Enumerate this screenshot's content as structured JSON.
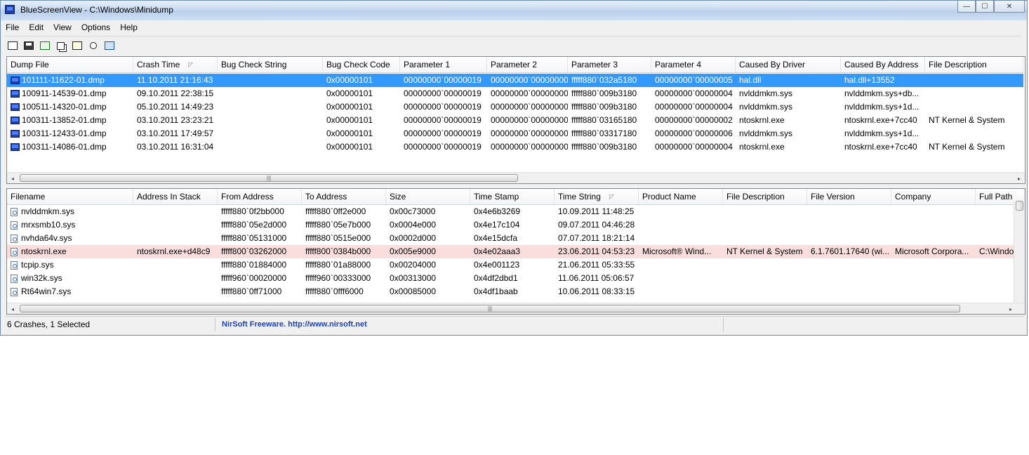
{
  "window": {
    "title": "BlueScreenView  -  C:\\Windows\\Minidump",
    "minimize_glyph": "—",
    "maximize_glyph": "☐",
    "close_glyph": "✕"
  },
  "menu": [
    "File",
    "Edit",
    "View",
    "Options",
    "Help"
  ],
  "toolbar": {
    "icons": [
      "html-report-icon",
      "save-icon",
      "refresh-icon",
      "copy-icon",
      "properties-icon",
      "find-icon",
      "exit-icon"
    ]
  },
  "crashes": {
    "columns": [
      "Dump File",
      "Crash Time",
      "Bug Check String",
      "Bug Check Code",
      "Parameter 1",
      "Parameter 2",
      "Parameter 3",
      "Parameter 4",
      "Caused By Driver",
      "Caused By Address",
      "File Description"
    ],
    "sorted_column": "Crash Time",
    "sort_glyph": "◸",
    "rows": [
      [
        "101111-11622-01.dmp",
        "11.10.2011 21:16:43",
        "",
        "0x00000101",
        "00000000`00000019",
        "00000000`00000000",
        "fffff880`032a5180",
        "00000000`00000005",
        "hal.dll",
        "hal.dll+13552",
        ""
      ],
      [
        "100911-14539-01.dmp",
        "09.10.2011 22:38:15",
        "",
        "0x00000101",
        "00000000`00000019",
        "00000000`00000000",
        "fffff880`009b3180",
        "00000000`00000004",
        "nvlddmkm.sys",
        "nvlddmkm.sys+db...",
        ""
      ],
      [
        "100511-14320-01.dmp",
        "05.10.2011 14:49:23",
        "",
        "0x00000101",
        "00000000`00000019",
        "00000000`00000000",
        "fffff880`009b3180",
        "00000000`00000004",
        "nvlddmkm.sys",
        "nvlddmkm.sys+1d...",
        ""
      ],
      [
        "100311-13852-01.dmp",
        "03.10.2011 23:23:21",
        "",
        "0x00000101",
        "00000000`00000019",
        "00000000`00000000",
        "fffff880`03165180",
        "00000000`00000002",
        "ntoskrnl.exe",
        "ntoskrnl.exe+7cc40",
        "NT Kernel & System"
      ],
      [
        "100311-12433-01.dmp",
        "03.10.2011 17:49:57",
        "",
        "0x00000101",
        "00000000`00000019",
        "00000000`00000000",
        "fffff880`03317180",
        "00000000`00000006",
        "nvlddmkm.sys",
        "nvlddmkm.sys+1d...",
        ""
      ],
      [
        "100311-14086-01.dmp",
        "03.10.2011 16:31:04",
        "",
        "0x00000101",
        "00000000`00000019",
        "00000000`00000000",
        "fffff880`009b3180",
        "00000000`00000004",
        "ntoskrnl.exe",
        "ntoskrnl.exe+7cc40",
        "NT Kernel & System"
      ]
    ],
    "selected_row": 0
  },
  "modules": {
    "columns": [
      "Filename",
      "Address In Stack",
      "From Address",
      "To Address",
      "Size",
      "Time Stamp",
      "Time String",
      "Product Name",
      "File Description",
      "File Version",
      "Company",
      "Full Path"
    ],
    "sorted_column": "Time String",
    "sort_glyph": "◸",
    "rows": [
      [
        "nvlddmkm.sys",
        "",
        "fffff880`0f2bb000",
        "fffff880`0ff2e000",
        "0x00c73000",
        "0x4e6b3269",
        "10.09.2011 11:48:25",
        "",
        "",
        "",
        "",
        ""
      ],
      [
        "mrxsmb10.sys",
        "",
        "fffff880`05e2d000",
        "fffff880`05e7b000",
        "0x0004e000",
        "0x4e17c104",
        "09.07.2011 04:46:28",
        "",
        "",
        "",
        "",
        ""
      ],
      [
        "nvhda64v.sys",
        "",
        "fffff880`05131000",
        "fffff880`0515e000",
        "0x0002d000",
        "0x4e15dcfa",
        "07.07.2011 18:21:14",
        "",
        "",
        "",
        "",
        ""
      ],
      [
        "ntoskrnl.exe",
        "ntoskrnl.exe+d48c9",
        "fffff800`03262000",
        "fffff800`0384b000",
        "0x005e9000",
        "0x4e02aaa3",
        "23.06.2011 04:53:23",
        "Microsoft® Wind...",
        "NT Kernel & System",
        "6.1.7601.17640 (wi...",
        "Microsoft Corpora...",
        "C:\\Windo"
      ],
      [
        "tcpip.sys",
        "",
        "fffff880`01884000",
        "fffff880`01a88000",
        "0x00204000",
        "0x4e001123",
        "21.06.2011 05:33:55",
        "",
        "",
        "",
        "",
        ""
      ],
      [
        "win32k.sys",
        "",
        "fffff960`00020000",
        "fffff960`00333000",
        "0x00313000",
        "0x4df2dbd1",
        "11.06.2011 05:06:57",
        "",
        "",
        "",
        "",
        ""
      ],
      [
        "Rt64win7.sys",
        "",
        "fffff880`0ff71000",
        "fffff880`0fff6000",
        "0x00085000",
        "0x4df1baab",
        "10.06.2011 08:33:15",
        "",
        "",
        "",
        "",
        ""
      ]
    ],
    "highlighted_row": 3
  },
  "status": {
    "count_text": "6 Crashes, 1 Selected",
    "link_text": "NirSoft Freeware.  http://www.nirsoft.net"
  },
  "scroll": {
    "left_glyph": "◂",
    "right_glyph": "▸",
    "grip_glyph": "|||"
  },
  "colors": {
    "selection": "#3399ff",
    "highlight": "#fadede",
    "link": "#1c3fbf"
  }
}
